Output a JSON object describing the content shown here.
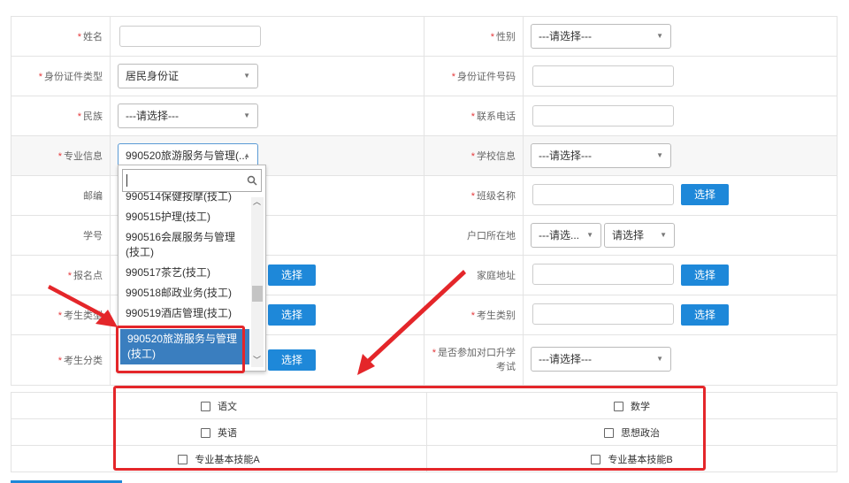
{
  "form": {
    "rows": [
      {
        "left_label": "姓名",
        "left_required": true,
        "right_label": "性别",
        "right_required": true
      },
      {
        "left_label": "身份证件类型",
        "left_required": true,
        "right_label": "身份证件号码",
        "right_required": true
      },
      {
        "left_label": "民族",
        "left_required": true,
        "right_label": "联系电话",
        "right_required": true
      },
      {
        "left_label": "专业信息",
        "left_required": true,
        "right_label": "学校信息",
        "right_required": true
      },
      {
        "left_label": "邮编",
        "left_required": false,
        "right_label": "班级名称",
        "right_required": true
      },
      {
        "left_label": "学号",
        "left_required": false,
        "right_label": "户口所在地",
        "right_required": false
      },
      {
        "left_label": "报名点",
        "left_required": true,
        "right_label": "家庭地址",
        "right_required": false
      },
      {
        "left_label": "考生类型",
        "left_required": true,
        "right_label": "考生类别",
        "right_required": true
      },
      {
        "left_label": "考生分类",
        "left_required": true,
        "right_label": "是否参加对口升学考试",
        "right_required": true
      }
    ],
    "gender_select": "---请选择---",
    "id_type_select": "居民身份证",
    "ethnicity_select": "---请选择---",
    "major_select": "990520旅游服务与管理(...",
    "school_select": "---请选择---",
    "hukou_select_1": "---请选...",
    "hukou_select_2": "请选择",
    "exam_select": "---请选择---",
    "select_button": "选择"
  },
  "dropdown": {
    "items": [
      {
        "label": "990514保健按摩(技工)"
      },
      {
        "label": "990515护理(技工)"
      },
      {
        "label": "990516会展服务与管理(技工)"
      },
      {
        "label": "990517茶艺(技工)"
      },
      {
        "label": "990518邮政业务(技工)"
      },
      {
        "label": "990519酒店管理(技工)"
      },
      {
        "label": "990520旅游服务与管理(技工)"
      }
    ],
    "selected_index": 6
  },
  "subjects": {
    "items": [
      "语文",
      "数学",
      "英语",
      "思想政治",
      "专业基本技能A",
      "专业基本技能B"
    ]
  },
  "colors": {
    "accent": "#1e88d9",
    "required": "#e4393c",
    "highlight": "#3a7ebf",
    "annotation": "#e4262a"
  },
  "icons": {
    "dropdown_arrow": "▲▼",
    "search": "search-icon"
  }
}
